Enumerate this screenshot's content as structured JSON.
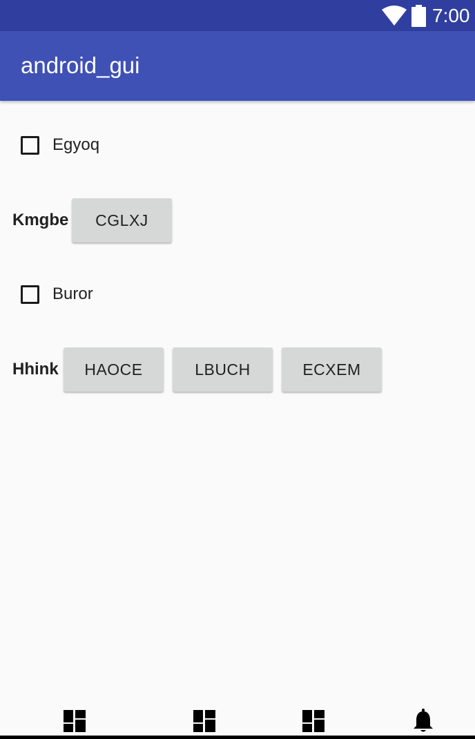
{
  "status_bar": {
    "time": "7:00",
    "icons": [
      "wifi-icon",
      "battery-icon"
    ]
  },
  "app_bar": {
    "title": "android_gui"
  },
  "form": {
    "checkbox_1": {
      "label": "Egyoq",
      "checked": false
    },
    "row_1": {
      "label": "Kmgbe",
      "buttons": [
        "CGLXJ"
      ]
    },
    "checkbox_2": {
      "label": "Buror",
      "checked": false
    },
    "row_2": {
      "label": "Hhink",
      "buttons": [
        "HAOCE",
        "LBUCH",
        "ECXEM"
      ]
    }
  },
  "bottom_nav": {
    "icons": [
      "dashboard-icon",
      "dashboard-icon",
      "dashboard-icon",
      "notifications-icon"
    ]
  },
  "colors": {
    "status_bar": "#303f9f",
    "app_bar": "#3f51b5",
    "background": "#fafafa",
    "button": "#d6d7d7"
  }
}
